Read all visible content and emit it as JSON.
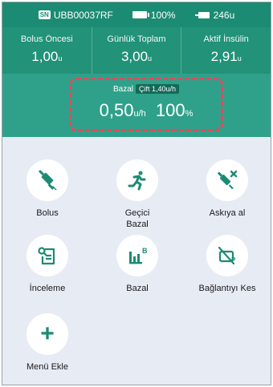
{
  "status": {
    "sn_badge": "SN",
    "serial": "UBB00037RF",
    "battery": "100%",
    "reservoir": "246u"
  },
  "stats": [
    {
      "label": "Bolus Öncesi",
      "value": "1,00",
      "unit": "u"
    },
    {
      "label": "Günlük Toplam",
      "value": "3,00",
      "unit": "u"
    },
    {
      "label": "Aktif İnsülin",
      "value": "2,91",
      "unit": "u"
    }
  ],
  "basal": {
    "label": "Bazal",
    "badge": "Çift 1,40u/h",
    "rate": "0,50",
    "rate_unit": "u/h",
    "percent": "100",
    "percent_unit": "%"
  },
  "menu": {
    "bolus": "Bolus",
    "temp_basal_line1": "Geçici",
    "temp_basal_line2": "Bazal",
    "suspend": "Askıya al",
    "review": "İnceleme",
    "basal": "Bazal",
    "disconnect": "Bağlantıyı Kes",
    "add_menu": "Menü Ekle",
    "plus_glyph": "+"
  },
  "colors": {
    "primary": "#1c8b73",
    "header": "#2fa18a",
    "highlight_dash": "#e8475a",
    "background": "#e7ebf4"
  }
}
